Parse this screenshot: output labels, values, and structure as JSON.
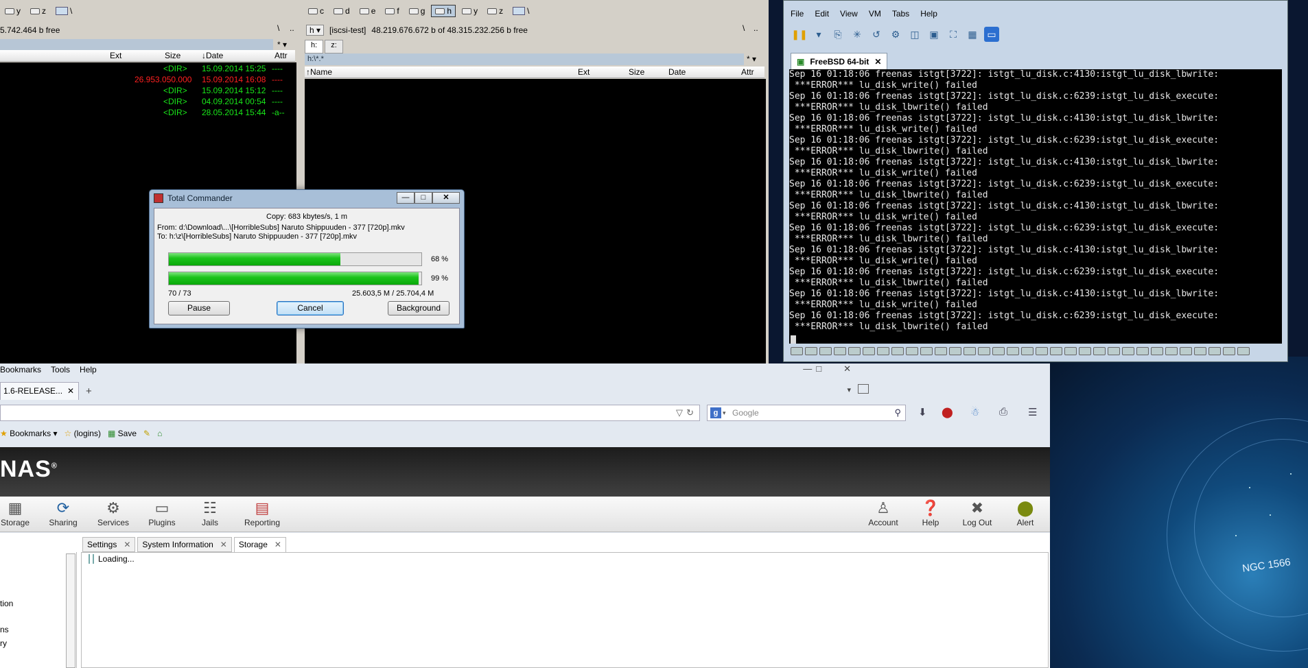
{
  "desktop": {
    "label": "NGC 1566"
  },
  "tc": {
    "left_drives": [
      "y",
      "z"
    ],
    "right_drives": [
      "c",
      "d",
      "e",
      "f",
      "g",
      "h",
      "y",
      "z"
    ],
    "left_free": "5.742.464 b free",
    "right_drive_sel": "h",
    "right_volume": "[iscsi-test]",
    "right_free": "48.219.676.672 b of 48.315.232.256 b free",
    "root_btn": "\\",
    "up_btn": "..",
    "right_tabs": [
      "h:",
      "z:"
    ],
    "right_path": "h:\\*.*",
    "filter": "*",
    "headers": {
      "ext": "Ext",
      "size": "Size",
      "date": "↓Date",
      "attr": "Attr"
    },
    "right_headers": {
      "name": "↑Name",
      "ext": "Ext",
      "size": "Size",
      "date": "Date",
      "attr": "Attr"
    },
    "left_files": [
      {
        "size": "<DIR>",
        "date": "15.09.2014 15:25",
        "attr": "----",
        "color": "#19e719"
      },
      {
        "size": "26.953.050.000",
        "date": "15.09.2014 16:08",
        "attr": "----",
        "color": "#ff2020"
      },
      {
        "size": "<DIR>",
        "date": "15.09.2014 15:12",
        "attr": "----",
        "color": "#19e719"
      },
      {
        "size": "<DIR>",
        "date": "04.09.2014 00:54",
        "attr": "----",
        "color": "#19e719"
      },
      {
        "size": "<DIR>",
        "date": "28.05.2014 15:44",
        "attr": "-a--",
        "color": "#19e719"
      }
    ]
  },
  "copy_dialog": {
    "title": "Total Commander",
    "speed": "Copy: 683 kbytes/s, 1 m",
    "from": "From: d:\\Download\\...\\[HorribleSubs] Naruto Shippuuden - 377 [720p].mkv",
    "to": "To:  h:\\z\\[HorribleSubs] Naruto Shippuuden - 377 [720p].mkv",
    "file_progress": 68,
    "file_progress_label": "68 %",
    "total_progress": 99,
    "total_progress_label": "99 %",
    "count": "70 / 73",
    "bytes": "25.603,5 M / 25.704,4 M",
    "pause": "Pause",
    "cancel": "Cancel",
    "background": "Background"
  },
  "vm": {
    "menu": [
      "File",
      "Edit",
      "View",
      "VM",
      "Tabs",
      "Help"
    ],
    "tab": "FreeBSD 64-bit",
    "console": [
      "Sep 16 01:18:06 freenas istgt[3722]: istgt_lu_disk.c:4130:istgt_lu_disk_lbwrite:",
      " ***ERROR*** lu_disk_write() failed",
      "Sep 16 01:18:06 freenas istgt[3722]: istgt_lu_disk.c:6239:istgt_lu_disk_execute:",
      " ***ERROR*** lu_disk_lbwrite() failed",
      "Sep 16 01:18:06 freenas istgt[3722]: istgt_lu_disk.c:4130:istgt_lu_disk_lbwrite:",
      " ***ERROR*** lu_disk_write() failed",
      "Sep 16 01:18:06 freenas istgt[3722]: istgt_lu_disk.c:6239:istgt_lu_disk_execute:",
      " ***ERROR*** lu_disk_lbwrite() failed",
      "Sep 16 01:18:06 freenas istgt[3722]: istgt_lu_disk.c:4130:istgt_lu_disk_lbwrite:",
      " ***ERROR*** lu_disk_write() failed",
      "Sep 16 01:18:06 freenas istgt[3722]: istgt_lu_disk.c:6239:istgt_lu_disk_execute:",
      " ***ERROR*** lu_disk_lbwrite() failed",
      "Sep 16 01:18:06 freenas istgt[3722]: istgt_lu_disk.c:4130:istgt_lu_disk_lbwrite:",
      " ***ERROR*** lu_disk_write() failed",
      "Sep 16 01:18:06 freenas istgt[3722]: istgt_lu_disk.c:6239:istgt_lu_disk_execute:",
      " ***ERROR*** lu_disk_lbwrite() failed",
      "Sep 16 01:18:06 freenas istgt[3722]: istgt_lu_disk.c:4130:istgt_lu_disk_lbwrite:",
      " ***ERROR*** lu_disk_write() failed",
      "Sep 16 01:18:06 freenas istgt[3722]: istgt_lu_disk.c:6239:istgt_lu_disk_execute:",
      " ***ERROR*** lu_disk_lbwrite() failed",
      "Sep 16 01:18:06 freenas istgt[3722]: istgt_lu_disk.c:4130:istgt_lu_disk_lbwrite:",
      " ***ERROR*** lu_disk_write() failed",
      "Sep 16 01:18:06 freenas istgt[3722]: istgt_lu_disk.c:6239:istgt_lu_disk_execute:",
      " ***ERROR*** lu_disk_lbwrite() failed"
    ]
  },
  "firefox": {
    "menu": [
      "Bookmarks",
      "Tools",
      "Help"
    ],
    "tab": "1.6-RELEASE...",
    "search_placeholder": "Google",
    "bookmarks": [
      "Bookmarks",
      "(logins)",
      "Save"
    ],
    "logo": "NAS",
    "nav_left": [
      "Storage",
      "Sharing",
      "Services",
      "Plugins",
      "Jails",
      "Reporting"
    ],
    "nav_right": [
      "Account",
      "Help",
      "Log Out",
      "Alert"
    ],
    "tabs": [
      "Settings",
      "System Information",
      "Storage"
    ],
    "loading": "Loading...",
    "side_items": [
      "tion",
      "ns",
      "ry"
    ]
  }
}
